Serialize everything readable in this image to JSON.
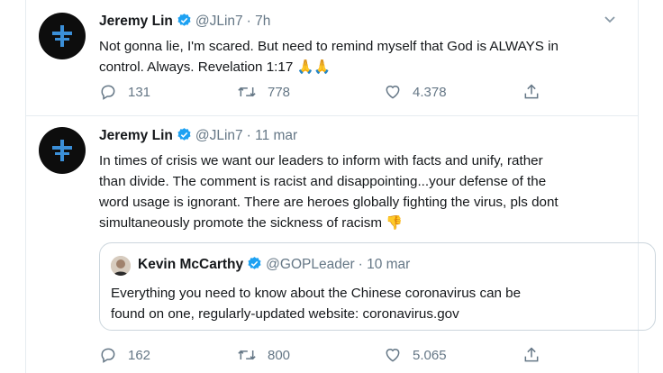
{
  "tweets": [
    {
      "author_name": "Jeremy Lin",
      "author_handle": "@JLin7",
      "time": "· 7h",
      "text_lines": [
        "Not gonna lie, I'm scared. But need to remind myself that God is ALWAYS in",
        "control. Always. Revelation 1:17 🙏🙏"
      ],
      "replies": "131",
      "retweets": "778",
      "likes": "4.378"
    },
    {
      "author_name": "Jeremy Lin",
      "author_handle": "@JLin7",
      "time": "· 11 mar",
      "text_lines": [
        "In times of crisis we want our leaders to inform with facts and unify, rather",
        "than divide. The comment is racist and disappointing...your defense of the",
        "word usage is ignorant. There are heroes globally fighting the virus, pls dont",
        "simultaneously promote the sickness of racism 👎"
      ],
      "quoted": {
        "author_name": "Kevin McCarthy",
        "author_handle": "@GOPLeader",
        "time": "· 10 mar",
        "text_lines": [
          "Everything you need to know about the Chinese coronavirus can be",
          "found on one, regularly-updated website: coronavirus.gov"
        ]
      },
      "replies": "162",
      "retweets": "800",
      "likes": "5.065"
    }
  ],
  "icons": {
    "avatar": "blue-cross-logo-icon",
    "verified": "verified-badge-icon",
    "caret": "chevron-down-icon",
    "reply": "reply-icon",
    "retweet": "retweet-icon",
    "like": "heart-icon",
    "share": "share-icon"
  },
  "colors": {
    "text": "#14171a",
    "secondary": "#657786",
    "verified": "#1da1f2",
    "border": "#e6ecf0",
    "avatar_bg": "#0d0d0d",
    "avatar_mark": "#3b8fd8"
  }
}
